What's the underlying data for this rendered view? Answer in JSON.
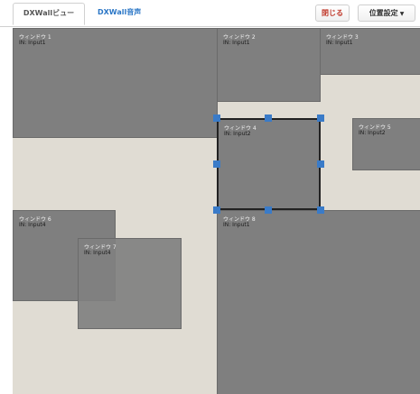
{
  "tabs": [
    {
      "label": "DXWallビュー"
    },
    {
      "label": "DXWall音声"
    }
  ],
  "buttons": {
    "close": "閉じる",
    "position": "位置設定"
  },
  "windows": [
    {
      "title": "ウィンドウ 1",
      "input": "IN: Input1"
    },
    {
      "title": "ウィンドウ 2",
      "input": "IN: Input1"
    },
    {
      "title": "ウィンドウ 3",
      "input": "IN: Input1"
    },
    {
      "title": "ウィンドウ 4",
      "input": "IN: Input2"
    },
    {
      "title": "ウィンドウ 5",
      "input": "IN: Input2"
    },
    {
      "title": "ウィンドウ 6",
      "input": "IN: Input4"
    },
    {
      "title": "ウィンドウ 7",
      "input": "IN: Input4"
    },
    {
      "title": "ウィンドウ 8",
      "input": "IN: Input1"
    }
  ],
  "colors": {
    "wall_background": "#e0dcd3",
    "window_fill": "#7f7f7f",
    "selection_handle": "#3a7bc8",
    "link_blue": "#2a76c6",
    "close_red": "#c0392b"
  }
}
